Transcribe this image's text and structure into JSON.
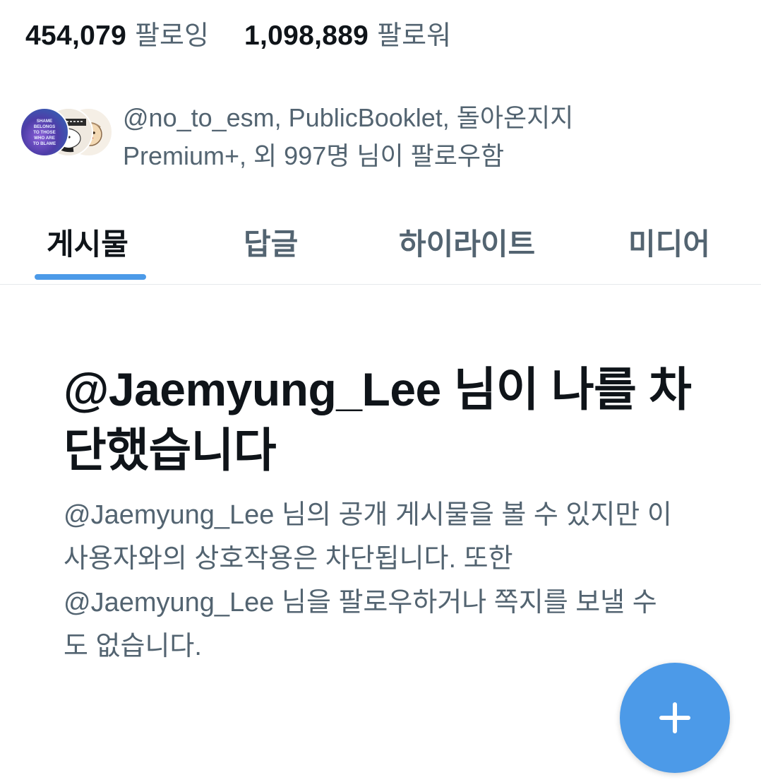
{
  "stats": {
    "following_count": "454,079",
    "following_label": "팔로잉",
    "followers_count": "1,098,889",
    "followers_label": "팔로워"
  },
  "followed_by": {
    "text": "@no_to_esm, PublicBooklet, 돌아온지지 Premium+, 외 997명 님이 팔로우함",
    "avatar1_text": "SHAME BELONGS TO THOSE WHO ARE TO BLAME"
  },
  "tabs": [
    {
      "label": "게시물",
      "active": true
    },
    {
      "label": "답글",
      "active": false
    },
    {
      "label": "하이라이트",
      "active": false
    },
    {
      "label": "미디어",
      "active": false
    }
  ],
  "blocked": {
    "title": "@Jaemyung_Lee 님이 나를 차단했습니다",
    "description": "@Jaemyung_Lee 님의 공개 게시물을 볼 수 있지만 이 사용자와의 상호작용은 차단됩니다. 또한 @Jaemyung_Lee 님을 팔로우하거나 쪽지를 보낼 수도 없습니다."
  },
  "fab": {
    "icon": "plus-icon"
  },
  "colors": {
    "primary_text": "#0f1419",
    "secondary_text": "#536471",
    "accent": "#4c9ae8",
    "divider": "#e6e9ec",
    "background": "#ffffff"
  }
}
